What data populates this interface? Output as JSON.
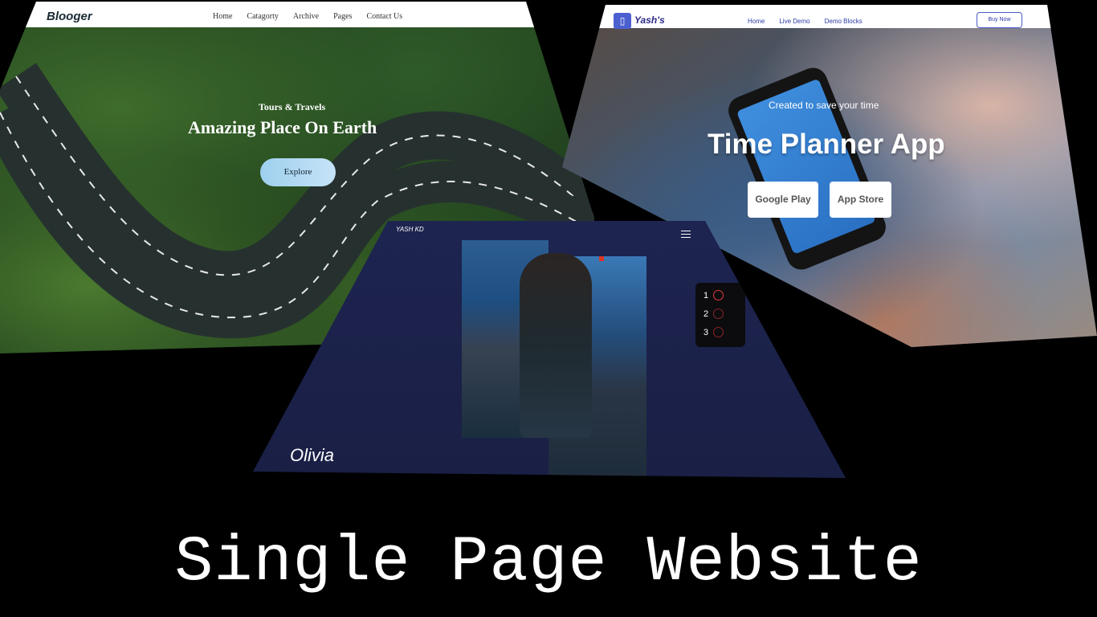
{
  "blooger": {
    "logo": "Blooger",
    "menu": [
      "Home",
      "Catagorty",
      "Archive",
      "Pages",
      "Contact Us"
    ],
    "subtitle": "Tours & Travels",
    "title": "Amazing Place On Earth",
    "button": "Explore"
  },
  "yash": {
    "logo": "Yash's",
    "logo_icon": "phone-icon",
    "menu": [
      "Home",
      "Live Demo",
      "Demo Blocks"
    ],
    "buy_button": "Buy Now",
    "subtitle": "Created to save your time",
    "title": "Time Planner App",
    "buttons": [
      "Google Play",
      "App Store"
    ]
  },
  "kd": {
    "logo": "YASH KD",
    "menu_icon": "hamburger-menu-icon",
    "name": "Olivia",
    "pages": [
      "1",
      "2",
      "3"
    ],
    "active_page": "1"
  },
  "caption": "Single Page Website",
  "colors": {
    "background": "#000000",
    "kd_panel": "#1d2450",
    "yash_accent": "#4c5fd1",
    "explore_button": "#9ed0ee"
  }
}
